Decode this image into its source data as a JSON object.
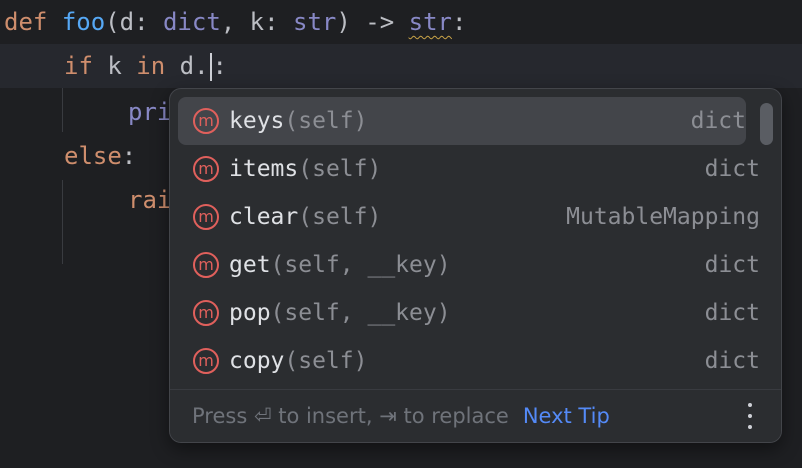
{
  "code": {
    "line1": {
      "kw_def": "def",
      "fn_name": "foo",
      "open": "(d: ",
      "type_dict": "dict",
      "mid": ", k: ",
      "type_str": "str",
      "close": ") -> ",
      "ret_type": "str",
      "colon": ":"
    },
    "line2": {
      "kw_if": "if",
      "var_k": " k ",
      "kw_in": "in",
      "expr": " d.",
      "colon": ":"
    },
    "line3": {
      "text": "pri"
    },
    "line4": {
      "kw_else": "else",
      "colon": ":"
    },
    "line5": {
      "text": "rai"
    }
  },
  "completion": {
    "items": [
      {
        "icon": "m",
        "name": "keys",
        "signature": "(self)",
        "type": "dict"
      },
      {
        "icon": "m",
        "name": "items",
        "signature": "(self)",
        "type": "dict"
      },
      {
        "icon": "m",
        "name": "clear",
        "signature": "(self)",
        "type": "MutableMapping"
      },
      {
        "icon": "m",
        "name": "get",
        "signature": "(self, __key)",
        "type": "dict"
      },
      {
        "icon": "m",
        "name": "pop",
        "signature": "(self, __key)",
        "type": "dict"
      },
      {
        "icon": "m",
        "name": "copy",
        "signature": "(self)",
        "type": "dict"
      }
    ],
    "selected_index": 0,
    "footer": {
      "hint": "Press ⏎ to insert, ⇥ to replace",
      "next_tip": "Next Tip"
    }
  },
  "colors": {
    "background": "#1e1f22",
    "keyword": "#cf8e6d",
    "function": "#56a8f5",
    "builtin_type": "#8888c6",
    "method_icon": "#e0605c",
    "link": "#548af7"
  }
}
